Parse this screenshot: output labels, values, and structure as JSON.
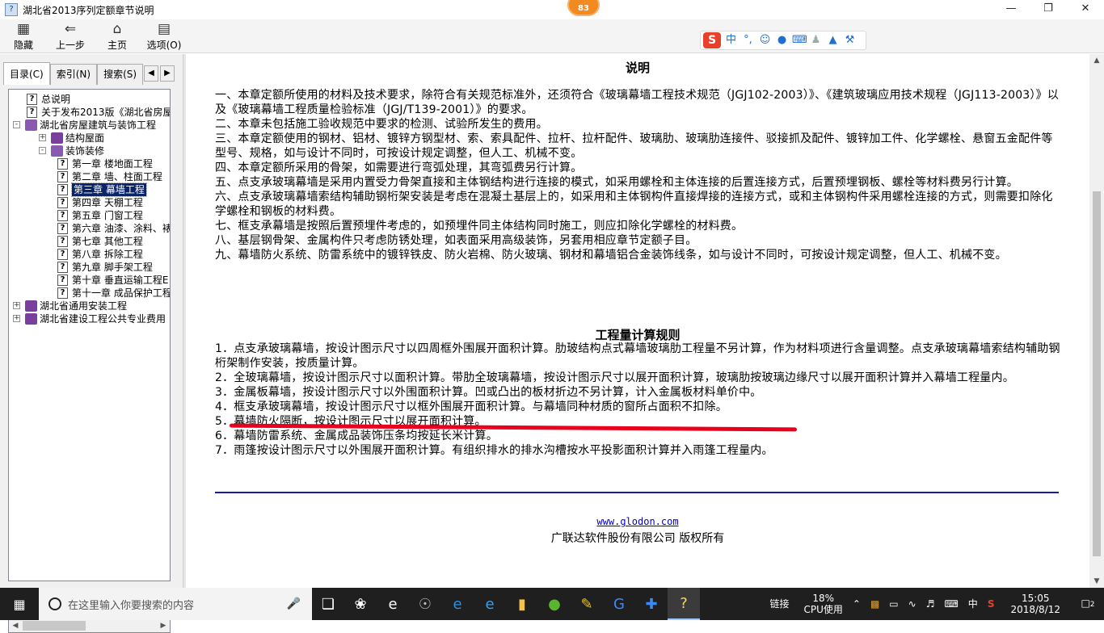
{
  "window": {
    "title": "湖北省2013序列定额章节说明",
    "badge": "83"
  },
  "toolbar": {
    "buttons": [
      {
        "label": "隐藏",
        "icon": "hide-icon"
      },
      {
        "label": "上一步",
        "icon": "back-arrow-icon"
      },
      {
        "label": "主页",
        "icon": "home-icon"
      },
      {
        "label": "选项(O)",
        "icon": "options-icon"
      }
    ]
  },
  "ime": {
    "logo": "S",
    "mode": "中"
  },
  "sidebar": {
    "tabs": [
      "目录(C)",
      "索引(N)",
      "搜索(S)"
    ],
    "tree": [
      {
        "label": "总说明",
        "type": "page",
        "level": 1
      },
      {
        "label": "关于发布2013版《湖北省房屋",
        "type": "page",
        "level": 1
      },
      {
        "label": "湖北省房屋建筑与装饰工程",
        "type": "book-open",
        "level": 0,
        "expander": "-"
      },
      {
        "label": "结构屋面",
        "type": "book",
        "level": 1,
        "expander": "+"
      },
      {
        "label": "装饰装修",
        "type": "book-open",
        "level": 1,
        "expander": "-"
      },
      {
        "label": "第一章 楼地面工程",
        "type": "page",
        "level": 2
      },
      {
        "label": "第二章 墙、柱面工程",
        "type": "page",
        "level": 2
      },
      {
        "label": "第三章 幕墙工程",
        "type": "page",
        "level": 2,
        "selected": true
      },
      {
        "label": "第四章 天棚工程",
        "type": "page",
        "level": 2
      },
      {
        "label": "第五章 门窗工程",
        "type": "page",
        "level": 2
      },
      {
        "label": "第六章 油漆、涂料、裱",
        "type": "page",
        "level": 2
      },
      {
        "label": "第七章 其他工程",
        "type": "page",
        "level": 2
      },
      {
        "label": "第八章 拆除工程",
        "type": "page",
        "level": 2
      },
      {
        "label": "第九章 脚手架工程",
        "type": "page",
        "level": 2
      },
      {
        "label": "第十章 垂直运输工程E",
        "type": "page",
        "level": 2
      },
      {
        "label": "第十一章 成品保护工程",
        "type": "page",
        "level": 2
      },
      {
        "label": "湖北省通用安装工程",
        "type": "book",
        "level": 0,
        "expander": "+"
      },
      {
        "label": "湖北省建设工程公共专业费用",
        "type": "book",
        "level": 0,
        "expander": "+"
      }
    ]
  },
  "content": {
    "heading1": "说明",
    "explanations": [
      "一、本章定额所使用的材料及技术要求，除符合有关规范标准外，还须符合《玻璃幕墙工程技术规范（JGJ102-2003）》、《建筑玻璃应用技术规程（JGJ113-2003）》以及《玻璃幕墙工程质量检验标准（JGJ/T139-2001）》的要求。",
      "二、本章未包括施工验收规范中要求的检测、试验所发生的费用。",
      "三、本章定额使用的钢材、铝材、镀锌方钢型材、索、索具配件、拉杆、拉杆配件、玻璃肋、玻璃肋连接件、驳接抓及配件、镀锌加工件、化学螺栓、悬窗五金配件等型号、规格，如与设计不同时，可按设计规定调整，但人工、机械不变。",
      "四、本章定额所采用的骨架，如需要进行弯弧处理，其弯弧费另行计算。",
      "五、点支承玻璃幕墙是采用内置受力骨架直接和主体钢结构进行连接的模式，如采用螺栓和主体连接的后置连接方式，后置预埋钢板、螺栓等材料费另行计算。",
      "六、点支承玻璃幕墙索结构辅助钢桁架安装是考虑在混凝土基层上的，如采用和主体钢构件直接焊接的连接方式，或和主体钢构件采用螺栓连接的方式，则需要扣除化学螺栓和钢板的材料费。",
      "七、框支承幕墙是按照后置预埋件考虑的，如预埋件同主体结构同时施工，则应扣除化学螺栓的材料费。",
      "八、基层钢骨架、金属构件只考虑防锈处理，如表面采用高级装饰，另套用相应章节定额子目。",
      "九、幕墙防火系统、防雷系统中的镀锌铁皮、防火岩棉、防火玻璃、钢材和幕墙铝合金装饰线条，如与设计不同时，可按设计规定调整，但人工、机械不变。"
    ],
    "heading2": "工程量计算规则",
    "rules": [
      "1．点支承玻璃幕墙，按设计图示尺寸以四周框外围展开面积计算。肋玻结构点式幕墙玻璃肋工程量不另计算，作为材料项进行含量调整。点支承玻璃幕墙索结构辅助钢桁架制作安装，按质量计算。",
      "2．全玻璃幕墙，按设计图示尺寸以面积计算。带肋全玻璃幕墙，按设计图示尺寸以展开面积计算，玻璃肋按玻璃边缘尺寸以展开面积计算并入幕墙工程量内。",
      "3．金属板幕墙，按设计图示尺寸以外围面积计算。凹或凸出的板材折边不另计算，计入金属板材料单价中。",
      "4．框支承玻璃幕墙，按设计图示尺寸以框外围展开面积计算。与幕墙同种材质的窗所占面积不扣除。",
      "5．幕墙防火隔断，按设计图示尺寸以展开面积计算。",
      "6．幕墙防雷系统、金属成品装饰压条均按延长米计算。",
      "7．雨篷按设计图示尺寸以外围展开面积计算。有组织排水的排水沟槽按水平投影面积计算并入雨篷工程量内。"
    ],
    "link": "www.glodon.com",
    "copyright": "广联达软件股份有限公司 版权所有"
  },
  "taskbar": {
    "search_placeholder": "在这里输入你要搜索的内容",
    "link_label": "链接",
    "cpu_percent": "18%",
    "cpu_label": "CPU使用",
    "lang": "中",
    "time": "15:05",
    "date": "2018/8/12",
    "notif": "2"
  }
}
